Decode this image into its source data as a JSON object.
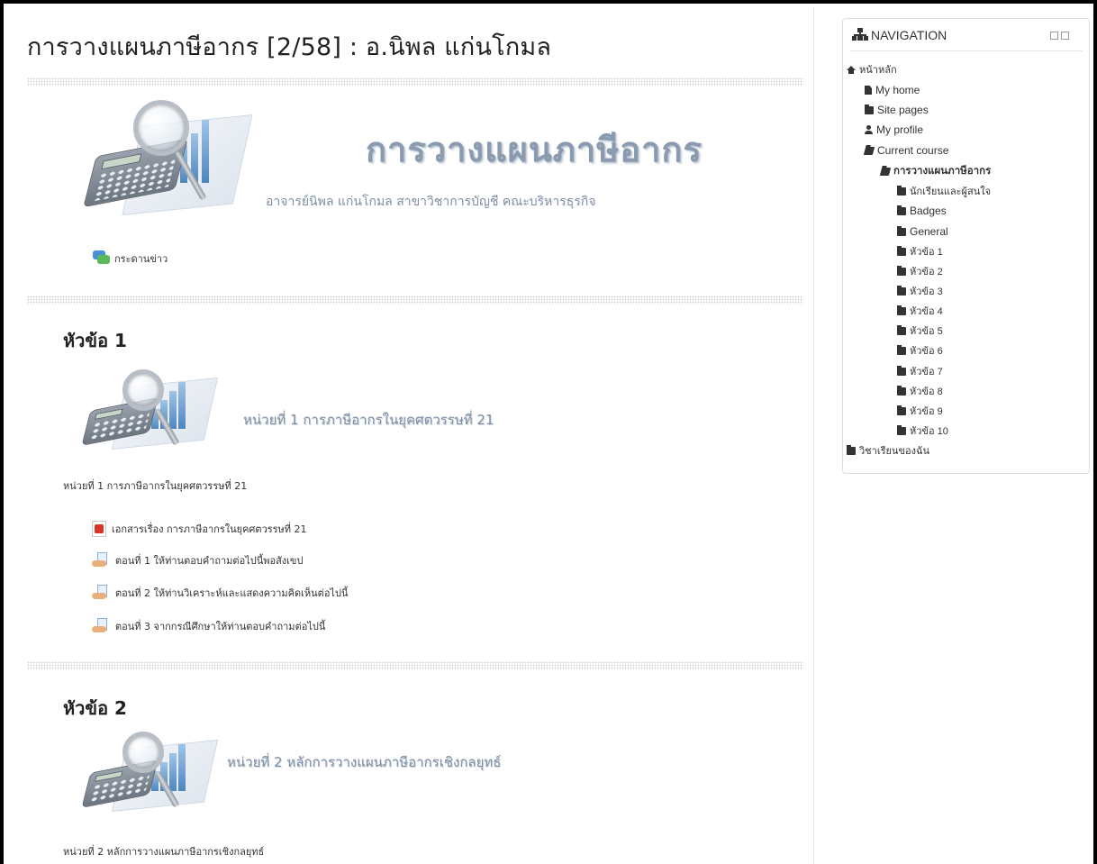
{
  "course": {
    "title": "การวางแผนภาษีอากร [2/58] : อ.นิพล แก่นโกมล",
    "banner_title": "การวางแผนภาษีอากร",
    "banner_subtitle": "อาจารย์นิพล แก่นโกมล สาขาวิชาการบัญชี คณะบริหารธุรกิจ",
    "news_forum": "กระดานข่าว"
  },
  "sections": [
    {
      "title": "หัวข้อ 1",
      "image_caption": "หน่วยที่ 1 การภาษีอากรในยุคศตวรรษที่ 21",
      "summary": "หน่วยที่ 1 การภาษีอากรในยุคศตวรรษที่ 21",
      "activities": [
        {
          "label": "เอกสารเรื่อง การภาษีอากรในยุคศตวรรษที่ 21",
          "icon": "pdf-icon"
        },
        {
          "label": "ตอนที่ 1 ให้ท่านตอบคำถามต่อไปนี้พอสังเขป",
          "icon": "assignment-icon"
        },
        {
          "label": "ตอนที่ 2 ให้ท่านวิเคราะห์และแสดงความคิดเห็นต่อไปนี้",
          "icon": "assignment-icon"
        },
        {
          "label": "ตอนที่ 3 จากกรณีศึกษาให้ท่านตอบคำถามต่อไปนี้",
          "icon": "assignment-icon"
        }
      ]
    },
    {
      "title": "หัวข้อ 2",
      "image_caption": "หน่วยที่ 2 หลักการวางแผนภาษีอากรเชิงกลยุทธ์",
      "summary": "หน่วยที่ 2 หลักการวางแผนภาษีอากรเชิงกลยุทธ์"
    }
  ],
  "navigation": {
    "title": "NAVIGATION",
    "items": [
      {
        "label": "หน้าหลัก",
        "icon": "home-icon"
      },
      {
        "label": "My home",
        "icon": "file-icon"
      },
      {
        "label": "Site pages",
        "icon": "folder-icon"
      },
      {
        "label": "My profile",
        "icon": "user-icon"
      },
      {
        "label": "Current course",
        "icon": "folder-open-icon"
      },
      {
        "label": "การวางแผนภาษีอากร",
        "icon": "folder-open-icon"
      },
      {
        "label": "นักเรียนและผู้สนใจ",
        "icon": "folder-icon"
      },
      {
        "label": "Badges",
        "icon": "folder-icon"
      },
      {
        "label": "General",
        "icon": "folder-icon"
      },
      {
        "label": "หัวข้อ 1",
        "icon": "folder-icon"
      },
      {
        "label": "หัวข้อ 2",
        "icon": "folder-icon"
      },
      {
        "label": "หัวข้อ 3",
        "icon": "folder-icon"
      },
      {
        "label": "หัวข้อ 4",
        "icon": "folder-icon"
      },
      {
        "label": "หัวข้อ 5",
        "icon": "folder-icon"
      },
      {
        "label": "หัวข้อ 6",
        "icon": "folder-icon"
      },
      {
        "label": "หัวข้อ 7",
        "icon": "folder-icon"
      },
      {
        "label": "หัวข้อ 8",
        "icon": "folder-icon"
      },
      {
        "label": "หัวข้อ 9",
        "icon": "folder-icon"
      },
      {
        "label": "หัวข้อ 10",
        "icon": "folder-icon"
      },
      {
        "label": "วิชาเรียนของฉัน",
        "icon": "folder-icon"
      }
    ]
  }
}
